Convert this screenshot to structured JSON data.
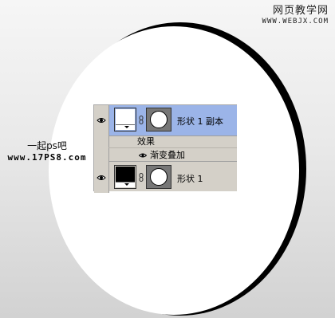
{
  "watermark_top": {
    "title": "网页教学网",
    "url": "WWW.WEBJX.COM"
  },
  "watermark_left": {
    "title": "一起ps吧",
    "url": "www.17PS8.com"
  },
  "layers_panel": {
    "layers": [
      {
        "name": "形状 1 副本",
        "selected": true,
        "thumb_color": "#ffffff"
      },
      {
        "name": "形状 1",
        "selected": false,
        "thumb_color": "#000000"
      }
    ],
    "effects_label": "效果",
    "effect_item": "渐变叠加"
  },
  "colors": {
    "selection": "#9bb4e8",
    "panel": "#d4d0c8",
    "shape_fill": "#ffffff",
    "shape_shadow": "#000000"
  }
}
